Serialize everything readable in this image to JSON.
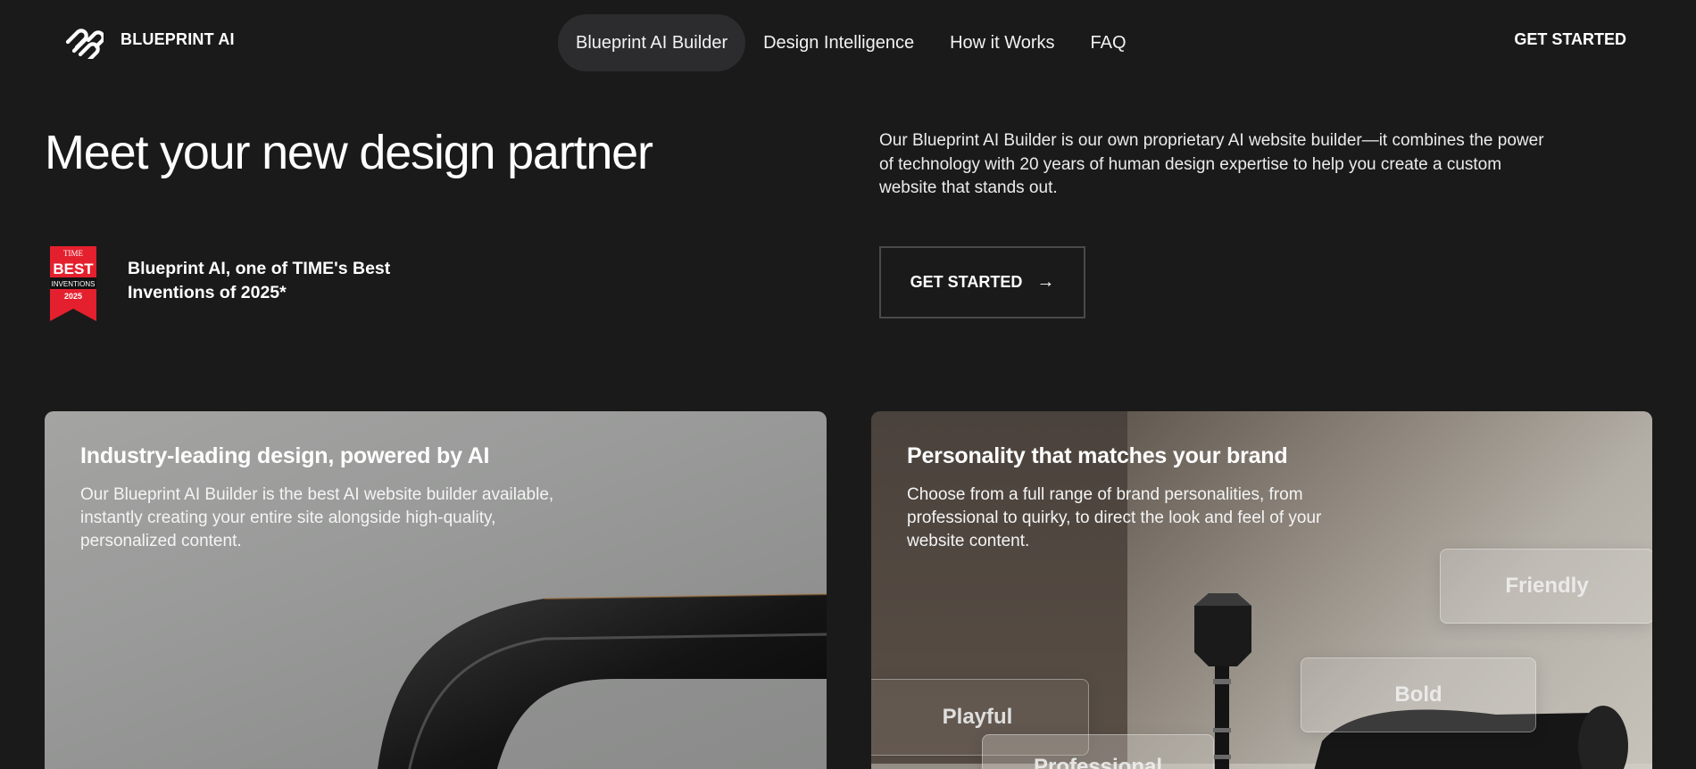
{
  "header": {
    "brand": "BLUEPRINT AI",
    "logo_icon": "squarespace-logo-icon",
    "nav": [
      {
        "label": "Blueprint AI Builder",
        "active": true
      },
      {
        "label": "Design Intelligence",
        "active": false
      },
      {
        "label": "How it Works",
        "active": false
      },
      {
        "label": "FAQ",
        "active": false
      }
    ],
    "cta": "GET STARTED"
  },
  "hero": {
    "title": "Meet your new design partner",
    "description": "Our Blueprint AI Builder is our own proprietary AI website builder—it combines the power of technology with 20 years of human design expertise to help you create a custom website that stands out.",
    "award_badge": {
      "line1": "TIME",
      "line2": "BEST",
      "line3": "INVENTIONS",
      "line4": "2025",
      "color": "#e5202e"
    },
    "award_text": "Blueprint AI, one of TIME's Best Inventions of 2025*",
    "cta": "GET STARTED",
    "cta_icon": "arrow-right-icon"
  },
  "cards": [
    {
      "title": "Industry-leading design, powered by AI",
      "body": "Our Blueprint AI Builder is the best AI website builder available, instantly creating your entire site alongside high-quality, personalized content."
    },
    {
      "title": "Personality that matches your brand",
      "body": "Choose from a full range of brand personalities, from professional to quirky, to direct the look and feel of your website content.",
      "tags": [
        "Friendly",
        "Bold",
        "Playful",
        "Professional"
      ]
    }
  ],
  "colors": {
    "background": "#1a1a1a",
    "nav_active": "#2c2c2e",
    "text": "#ffffff"
  }
}
